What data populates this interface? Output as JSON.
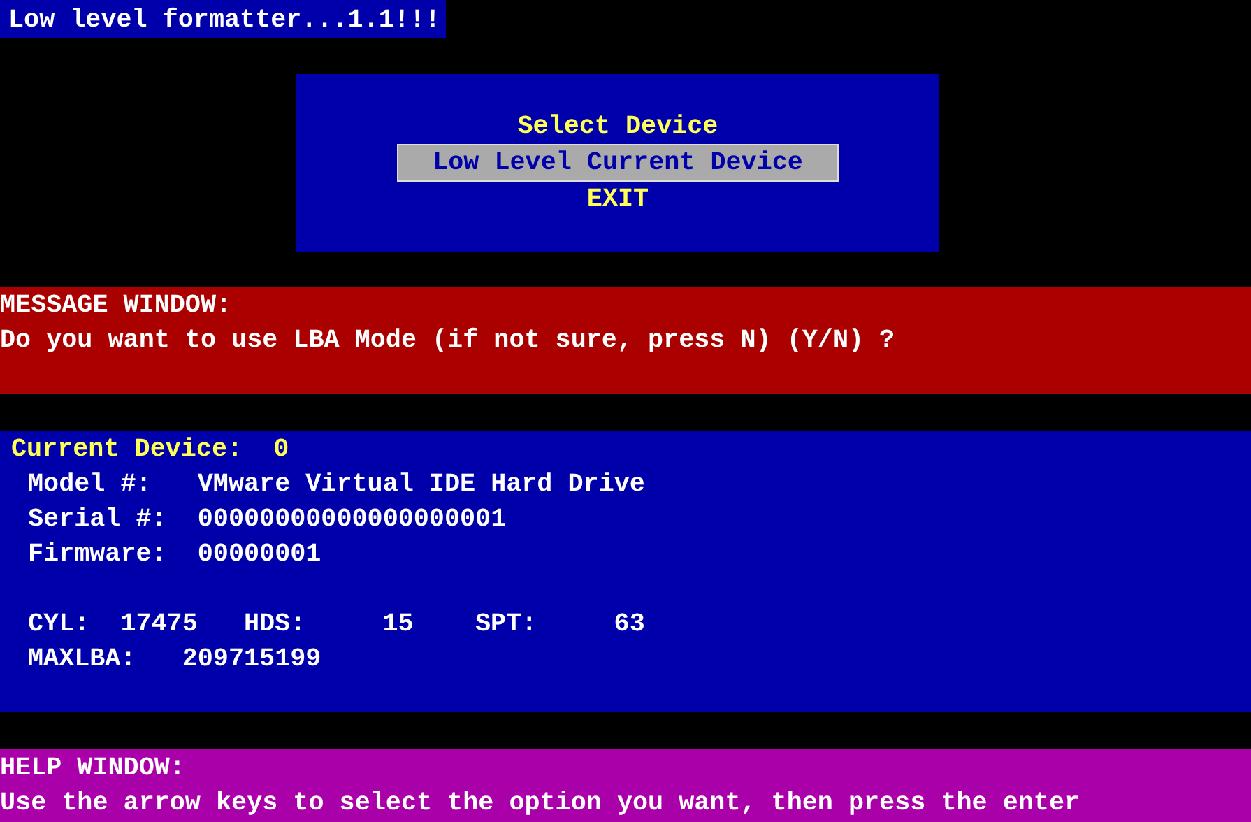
{
  "title_bar": {
    "title": "Low level formatter...1.1!!!"
  },
  "menu": {
    "heading": "Select Device",
    "items": [
      {
        "label": "Low Level Current Device",
        "selected": true
      },
      {
        "label": "EXIT",
        "selected": false
      }
    ]
  },
  "message_window": {
    "title": "MESSAGE WINDOW:",
    "text": "Do you want to use LBA Mode (if not sure, press N) (Y/N) ?"
  },
  "device_panel": {
    "current_label": "Current Device:",
    "current_value": "0",
    "fields": [
      {
        "label": "Model #:",
        "value": "VMware Virtual IDE Hard Drive"
      },
      {
        "label": "Serial #:",
        "value": "00000000000000000001"
      },
      {
        "label": "Firmware:",
        "value": "00000001"
      }
    ],
    "geometry": [
      {
        "label": "CYL:",
        "value": "17475"
      },
      {
        "label": "HDS:",
        "value": "15"
      },
      {
        "label": "SPT:",
        "value": "63"
      }
    ],
    "maxlba_label": "MAXLBA:",
    "maxlba_value": "209715199"
  },
  "help_window": {
    "title": "HELP WINDOW:",
    "text": "Use the arrow keys to select the option you want, then press the enter"
  }
}
